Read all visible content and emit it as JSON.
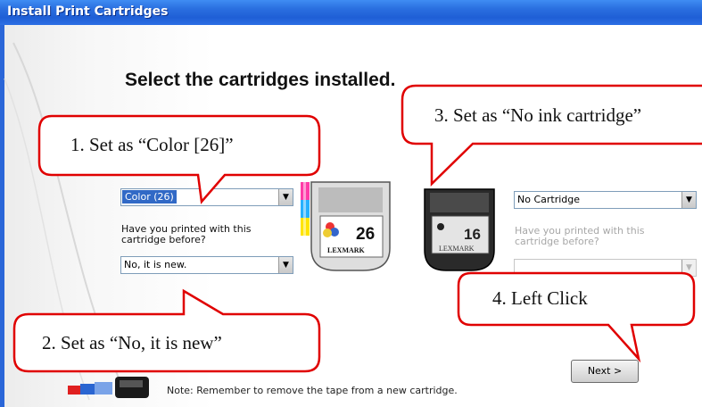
{
  "window": {
    "title": "Install Print Cartridges"
  },
  "heading": "Select the cartridges installed.",
  "left": {
    "cartridge_select": "Color (26)",
    "question": "Have you printed with this cartridge before?",
    "question_line1": "Have you printed with this",
    "question_line2": "cartridge before?",
    "new_select": "No, it is new."
  },
  "right": {
    "cartridge_select": "No Cartridge",
    "question_line1": "Have you printed with this",
    "question_line2": "cartridge before?"
  },
  "cartridges": {
    "color": {
      "number": "26",
      "brand": "LEXMARK"
    },
    "black": {
      "number": "16",
      "brand": "LEXMARK"
    }
  },
  "callouts": {
    "step1": "1. Set as “Color [26]”",
    "step2": "2. Set as “No, it is new”",
    "step3": "3. Set as “No ink cartridge”",
    "step4": "4. Left Click"
  },
  "buttons": {
    "next": "Next >"
  },
  "note": "Note: Remember to remove the tape from a new cartridge.",
  "colors": {
    "titlebar": "#2a6fe0",
    "callout_border": "#e00000",
    "selection": "#3169c6"
  }
}
